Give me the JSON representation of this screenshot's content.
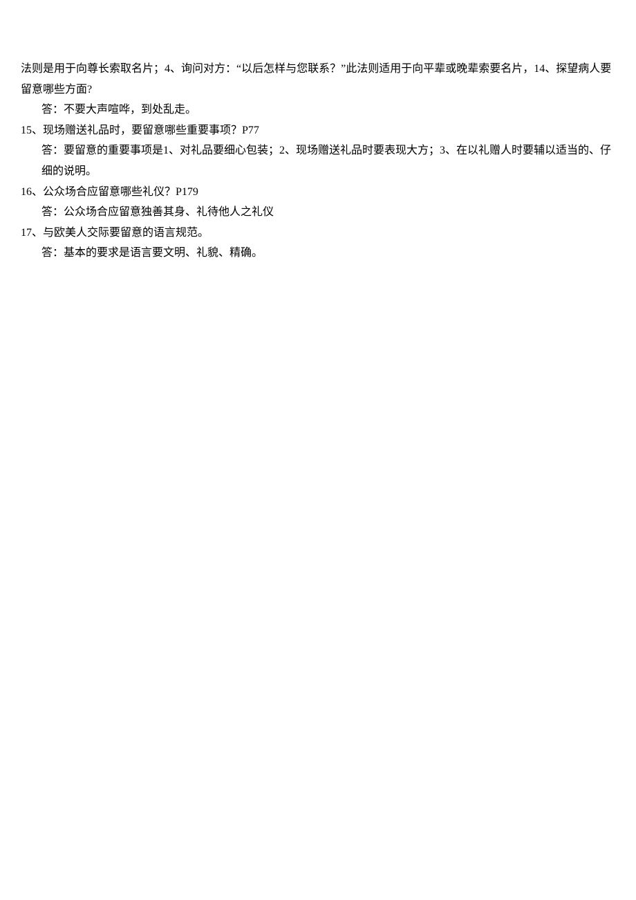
{
  "lines": [
    {
      "text": "法则是用于向尊长索取名片；4、询问对方：“以后怎样与您联系？”此法则适用于向平辈或晚辈索要名片，14、探望病人要留意哪些方面?",
      "indent": 0
    },
    {
      "text": "答：不要大声喧哗，到处乱走。",
      "indent": 1
    },
    {
      "text": "15、现场赠送礼品时，要留意哪些重要事项？P77",
      "indent": 0
    },
    {
      "text": "答：要留意的重要事项是1、对礼品要细心包装；2、现场赠送礼品时要表现大方；3、在以礼赠人时要辅以适当的、仔细的说明。",
      "indent": 1
    },
    {
      "text": "16、公众场合应留意哪些礼仪？P179",
      "indent": 0
    },
    {
      "text": "答：公众场合应留意独善其身、礼待他人之礼仪",
      "indent": 1
    },
    {
      "text": "17、与欧美人交际要留意的语言规范。",
      "indent": 0
    },
    {
      "text": "答：基本的要求是语言要文明、礼貌、精确。",
      "indent": 1
    }
  ]
}
